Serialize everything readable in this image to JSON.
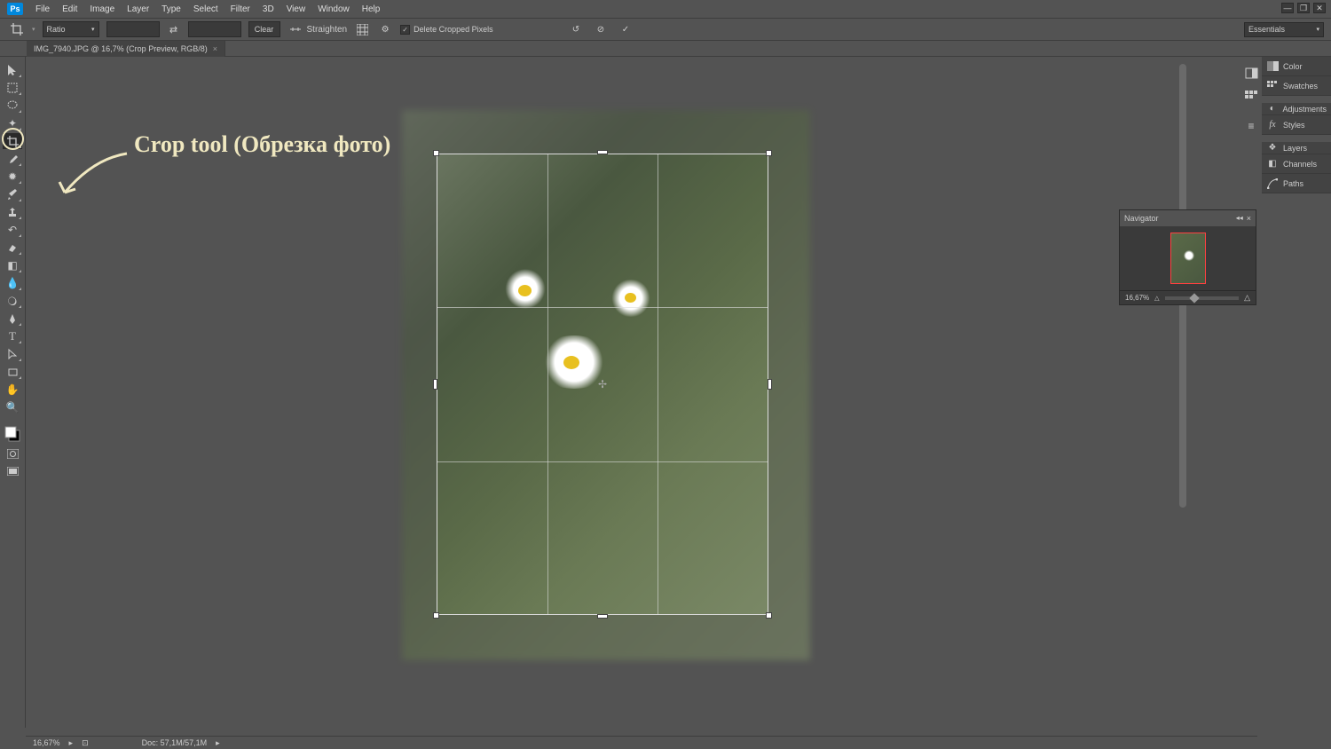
{
  "app": {
    "logo": "Ps"
  },
  "menu": [
    "File",
    "Edit",
    "Image",
    "Layer",
    "Type",
    "Select",
    "Filter",
    "3D",
    "View",
    "Window",
    "Help"
  ],
  "options": {
    "preset": "Ratio",
    "clear": "Clear",
    "straighten": "Straighten",
    "delete_cropped": "Delete Cropped Pixels",
    "workspace": "Essentials"
  },
  "tab": {
    "title": "IMG_7940.JPG @ 16,7% (Crop Preview, RGB/8)"
  },
  "annotation": "Crop tool (Обрезка фото)",
  "panels": {
    "color": "Color",
    "swatches": "Swatches",
    "adjustments": "Adjustments",
    "styles": "Styles",
    "layers": "Layers",
    "channels": "Channels",
    "paths": "Paths"
  },
  "navigator": {
    "title": "Navigator",
    "zoom": "16,67%"
  },
  "status": {
    "zoom": "16,67%",
    "doc": "Doc: 57,1M/57,1M"
  }
}
